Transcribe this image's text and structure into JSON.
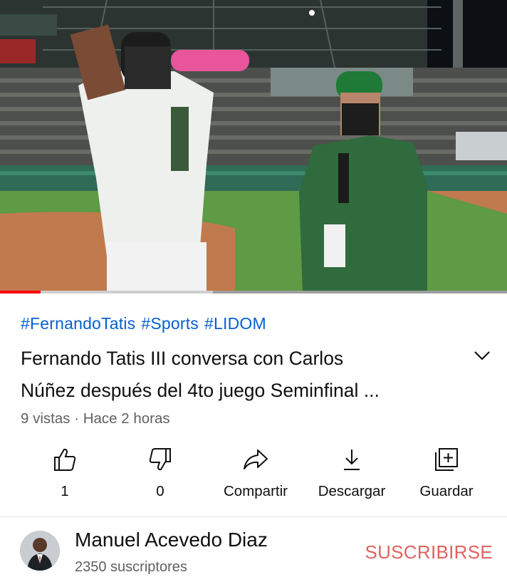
{
  "video": {
    "progress_fraction": 0.08,
    "buffered_fraction": 0.42,
    "accent": "#ff0000"
  },
  "hashtags": [
    "#FernandoTatis",
    "#Sports",
    "#LIDOM"
  ],
  "title": {
    "line1": "Fernando Tatis III conversa con Carlos",
    "line2": "Núñez después del 4to juego Seminfinal ..."
  },
  "meta": {
    "views_time": "9 vistas · Hace 2 horas"
  },
  "actions": {
    "like": {
      "label": "1",
      "icon": "thumbs-up-icon"
    },
    "dislike": {
      "label": "0",
      "icon": "thumbs-down-icon"
    },
    "share": {
      "label": "Compartir",
      "icon": "share-icon"
    },
    "download": {
      "label": "Descargar",
      "icon": "download-icon"
    },
    "save": {
      "label": "Guardar",
      "icon": "playlist-add-icon"
    }
  },
  "channel": {
    "name": "Manuel Acevedo Diaz",
    "subscribers": "2350 suscriptores",
    "subscribe_label": "SUSCRIBIRSE",
    "subscribe_color": "#e0625f"
  }
}
